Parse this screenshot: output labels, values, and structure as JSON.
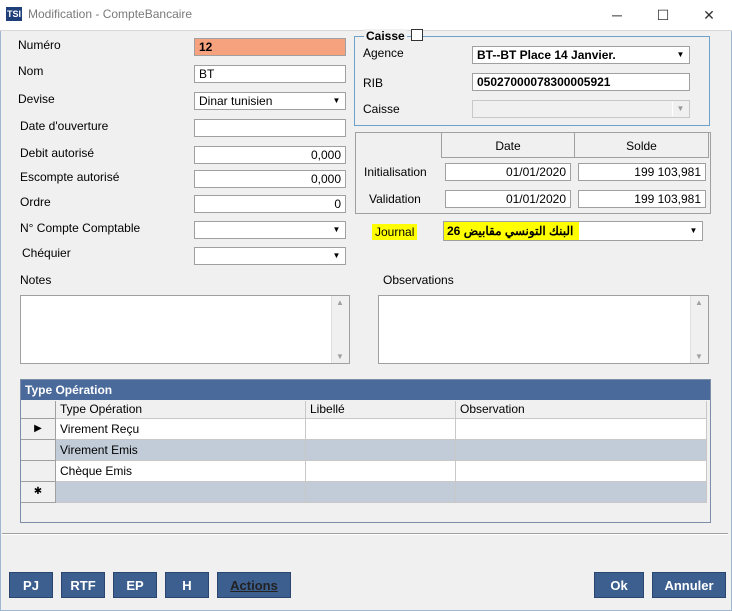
{
  "window": {
    "title": "Modification - CompteBancaire",
    "icon_text": "TSI",
    "minimize_glyph": "─",
    "maximize_glyph": "☐",
    "close_glyph": "✕"
  },
  "left": {
    "numero_label": "Numéro",
    "numero_value": "12",
    "nom_label": "Nom",
    "nom_value": "BT",
    "devise_label": "Devise",
    "devise_value": "Dinar tunisien",
    "date_ouverture_label": "Date d'ouverture",
    "date_ouverture_value": "",
    "debit_label": "Debit autorisé",
    "debit_value": "0,000",
    "escompte_label": "Escompte autorisé",
    "escompte_value": "0,000",
    "ordre_label": "Ordre",
    "ordre_value": "0",
    "compte_label": "N° Compte Comptable",
    "compte_value": "",
    "chequier_label": "Chéquier",
    "chequier_value": ""
  },
  "caisse": {
    "legend": "Caisse",
    "agence_label": "Agence",
    "agence_value": "BT--BT Place 14 Janvier.",
    "rib_label": "RIB",
    "rib_value": "05027000078300005921",
    "caisse_label": "Caisse",
    "caisse_value": ""
  },
  "solde_grid": {
    "col_date": "Date",
    "col_solde": "Solde",
    "rows": [
      {
        "label": "Initialisation",
        "date": "01/01/2020",
        "solde": "199 103,981"
      },
      {
        "label": "Validation",
        "date": "01/01/2020",
        "solde": "199 103,981"
      }
    ]
  },
  "journal": {
    "label": "Journal",
    "value": "26  البنك التونسي  مقابيض",
    "highlight_color": "#ffff00"
  },
  "notes_label": "Notes",
  "observations_label": "Observations",
  "table": {
    "title": "Type Opération",
    "columns": [
      "Type Opération",
      "Libellé",
      "Observation"
    ],
    "rows": [
      {
        "marker": "▶",
        "type": "Virement Reçu",
        "libelle": "",
        "observation": ""
      },
      {
        "marker": "",
        "type": "Virement Emis",
        "libelle": "",
        "observation": ""
      },
      {
        "marker": "",
        "type": "Chèque Emis",
        "libelle": "",
        "observation": ""
      },
      {
        "marker": "✱",
        "type": "",
        "libelle": "",
        "observation": ""
      }
    ]
  },
  "buttons": {
    "pj": "PJ",
    "rtf": "RTF",
    "ep": "EP",
    "h": "H",
    "actions": "Actions",
    "ok": "Ok",
    "annuler": "Annuler"
  },
  "colors": {
    "numero_bg": "#f7a27f",
    "button_bg": "#3c5f8f",
    "table_header_bg": "#4a6a9b",
    "row_alt_bg": "#c1ccd8"
  }
}
